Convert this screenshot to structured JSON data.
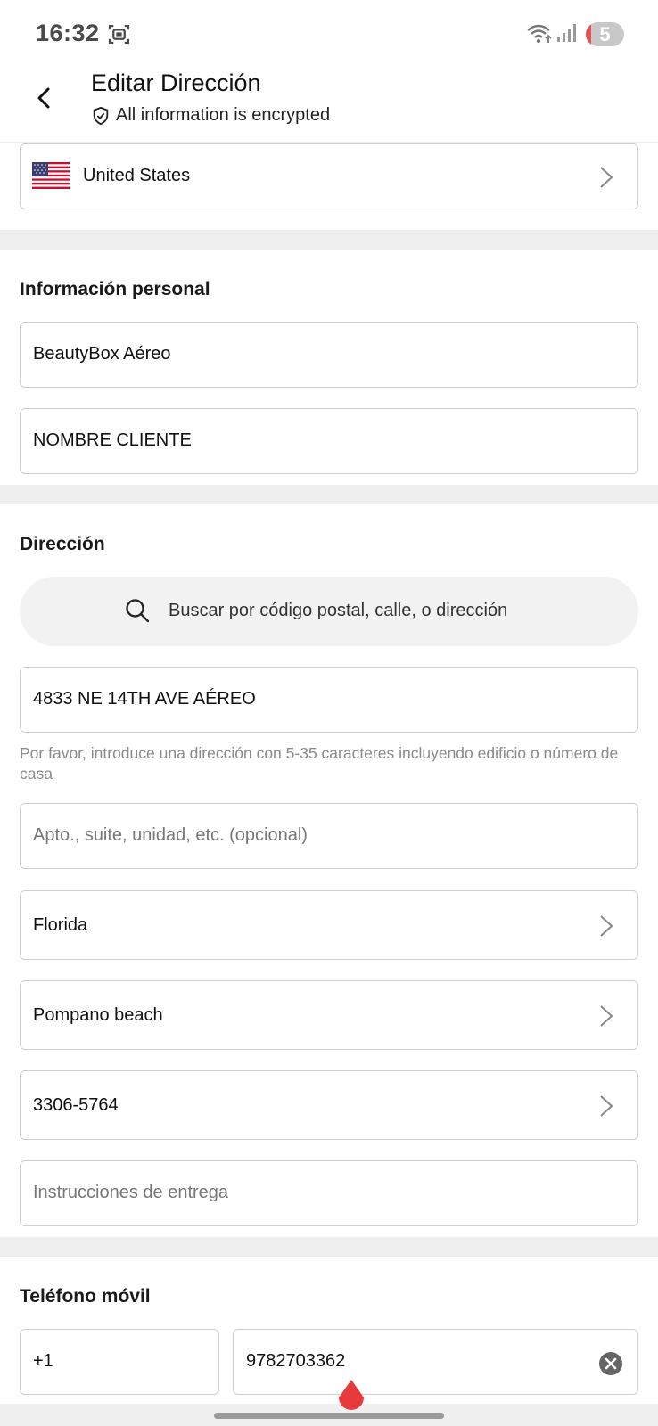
{
  "status_bar": {
    "time": "16:32",
    "battery_level": "5",
    "icons": [
      "screen-record-icon",
      "wifi-icon",
      "signal-icon",
      "battery-icon"
    ]
  },
  "header": {
    "title": "Editar Dirección",
    "subtitle": "All information is encrypted"
  },
  "country": {
    "name": "United States",
    "flag": "us-flag-icon"
  },
  "personal": {
    "title": "Información personal",
    "first_name": "BeautyBox Aéreo",
    "last_name": "NOMBRE CLIENTE"
  },
  "address": {
    "title": "Dirección",
    "search_placeholder": "Buscar por código postal, calle, o dirección",
    "street": "4833 NE 14TH AVE AÉREO",
    "street_helper": "Por favor, introduce una dirección con 5-35 caracteres incluyendo edificio o número de casa",
    "apt_placeholder": "Apto., suite, unidad, etc. (opcional)",
    "state": "Florida",
    "city": "Pompano beach",
    "zip": "3306-5764",
    "instructions_placeholder": "Instrucciones de entrega"
  },
  "phone": {
    "title": "Teléfono móvil",
    "code": "+1",
    "number": "9782703362"
  },
  "colors": {
    "accent": "#e83a3a",
    "border": "#cfcfcf",
    "divider": "#efefef"
  }
}
